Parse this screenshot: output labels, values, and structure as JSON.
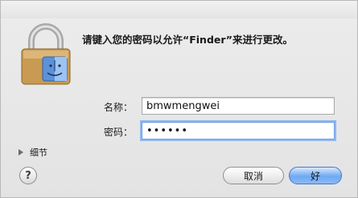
{
  "dialog": {
    "message": "请键入您的密码以允许“Finder”来进行更改。",
    "name_label": "名称：",
    "name_value": "bmwmengwei",
    "password_label": "密码：",
    "password_value": "••••••",
    "details_label": "细节",
    "help_label": "?",
    "cancel_label": "取消",
    "ok_label": "好"
  },
  "icons": {
    "lock": "lock-icon",
    "app": "finder-icon",
    "disclosure": "disclosure-triangle-icon"
  },
  "colors": {
    "accent": "#6fa9f2",
    "focus_ring": "#8fb8f0"
  }
}
